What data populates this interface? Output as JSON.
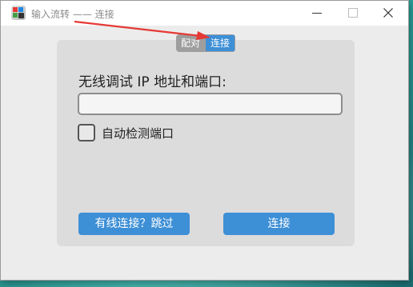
{
  "window": {
    "title": "输入流转 —— 连接"
  },
  "tabs": [
    {
      "label": "配对",
      "selected": false
    },
    {
      "label": "连接",
      "selected": true
    }
  ],
  "form": {
    "ip_label": "无线调试 IP 地址和端口:",
    "ip_value": "",
    "auto_detect_label": "自动检测端口",
    "auto_detect_checked": false
  },
  "buttons": {
    "skip_label": "有线连接？跳过",
    "connect_label": "连接"
  },
  "colors": {
    "accent": "#3d8fd6",
    "annotation_arrow": "#e53935"
  },
  "icons": {
    "app": "app-icon",
    "minimize": "minimize-icon",
    "maximize": "maximize-icon",
    "close": "close-icon"
  }
}
